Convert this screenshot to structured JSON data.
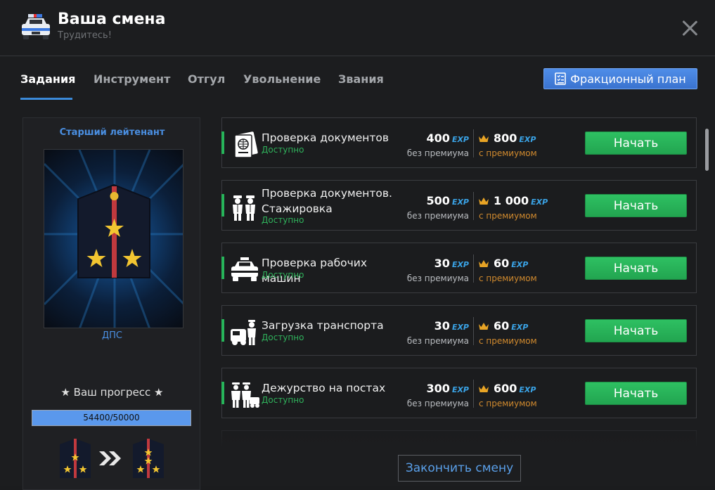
{
  "header": {
    "title": "Ваша смена",
    "subtitle": "Трудитесь!",
    "icon": "police-car-icon"
  },
  "tabs": [
    {
      "label": "Задания",
      "active": true
    },
    {
      "label": "Инструмент",
      "active": false
    },
    {
      "label": "Отгул",
      "active": false
    },
    {
      "label": "Увольнение",
      "active": false
    },
    {
      "label": "Звания",
      "active": false
    }
  ],
  "faction_plan_button": "Фракционный план",
  "rank": {
    "title": "Старший лейтенант",
    "organization": "ДПС",
    "progress_label": "★ Ваш прогресс ★",
    "progress_text": "54400/50000",
    "progress_fraction": 1.0
  },
  "tasks": [
    {
      "name": "Проверка документов",
      "status": "Доступно",
      "exp_base": "400",
      "exp_premium": "800",
      "icon": "passport-icon"
    },
    {
      "name": "Проверка документов. Стажировка",
      "status": "Доступно",
      "exp_base": "500",
      "exp_premium": "1 000",
      "icon": "officers-icon"
    },
    {
      "name": "Проверка рабочих машин",
      "status": "Доступно",
      "exp_base": "30",
      "exp_premium": "60",
      "icon": "police-car-icon"
    },
    {
      "name": "Загрузка транспорта",
      "status": "Доступно",
      "exp_base": "30",
      "exp_premium": "60",
      "icon": "tow-officer-icon"
    },
    {
      "name": "Дежурство на постах",
      "status": "Доступно",
      "exp_base": "300",
      "exp_premium": "600",
      "icon": "patrol-post-icon"
    }
  ],
  "labels": {
    "exp": "EXP",
    "no_premium": "без премиума",
    "with_premium": "с премиумом",
    "start": "Начать"
  },
  "finish_button": "Закончить смену",
  "colors": {
    "accent": "#3b8ad9",
    "start_green": "#27b45a",
    "premium_orange": "#d18a2e"
  }
}
